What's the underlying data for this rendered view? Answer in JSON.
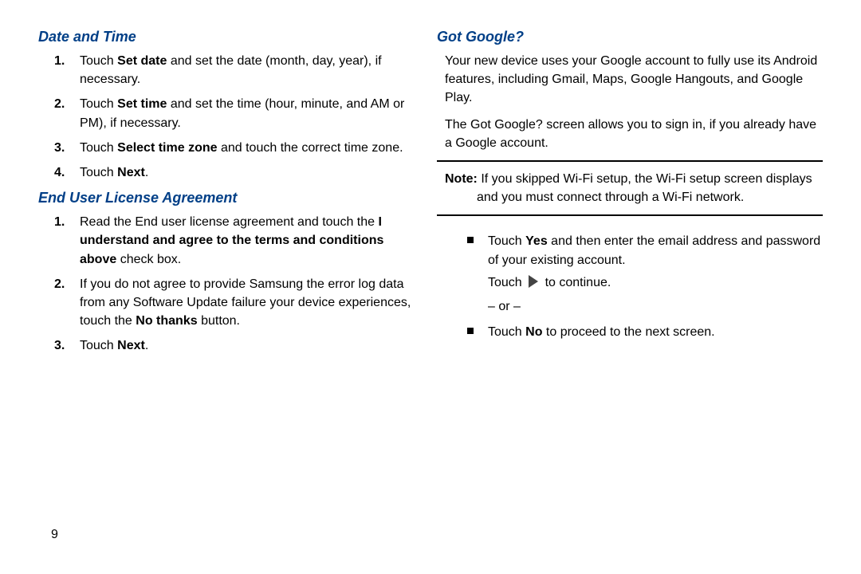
{
  "col1": {
    "section1": {
      "heading": "Date and Time",
      "steps": {
        "s1a": "Touch ",
        "s1b": "Set date",
        "s1c": " and set the date (month, day, year), if necessary.",
        "s2a": "Touch ",
        "s2b": "Set time",
        "s2c": " and set the time (hour, minute, and AM or PM), if necessary.",
        "s3a": "Touch ",
        "s3b": "Select time zone",
        "s3c": " and touch the correct time zone.",
        "s4a": "Touch ",
        "s4b": "Next",
        "s4c": "."
      }
    },
    "section2": {
      "heading": "End User License Agreement",
      "steps": {
        "s1a": "Read the End user license agreement and touch the ",
        "s1b": "I understand and agree to the terms and conditions above",
        "s1c": " check box.",
        "s2a": "If you do not agree to provide Samsung the error log data from any Software Update failure your device experiences, touch the ",
        "s2b": "No thanks",
        "s2c": " button.",
        "s3a": "Touch ",
        "s3b": "Next",
        "s3c": "."
      }
    }
  },
  "col2": {
    "section1": {
      "heading": "Got Google?",
      "p1": "Your new device uses your Google account to fully use its Android features, including Gmail, Maps, Google Hangouts, and Google Play.",
      "p2": "The Got Google? screen allows you to sign in, if you already have a Google account.",
      "note_label": "Note:",
      "note_body": " If you skipped Wi-Fi setup, the Wi-Fi setup screen displays and you must connect through a Wi-Fi network.",
      "bullets": {
        "b1a": "Touch ",
        "b1b": "Yes",
        "b1c": " and then enter the email address and password of your existing account.",
        "b1_touch": "Touch ",
        "b1_cont": " to continue.",
        "b1_or": "– or –",
        "b2a": "Touch ",
        "b2b": "No",
        "b2c": " to proceed to the next screen."
      }
    }
  },
  "page_number": "9"
}
